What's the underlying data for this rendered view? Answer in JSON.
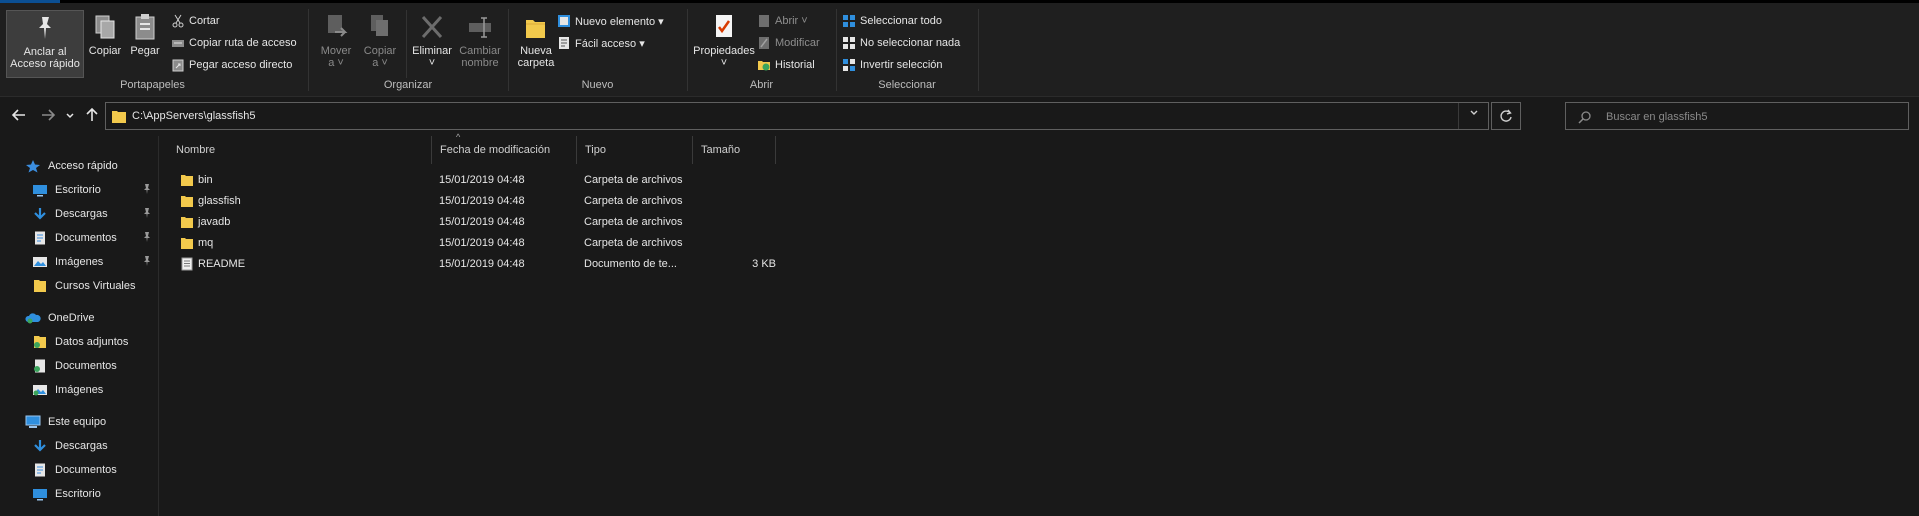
{
  "ribbon": {
    "portapapeles": {
      "label": "Portapapeles",
      "anclar_line1": "Anclar al",
      "anclar_line2": "Acceso rápido",
      "copiar": "Copiar",
      "pegar": "Pegar",
      "cortar": "Cortar",
      "copiar_ruta": "Copiar ruta de acceso",
      "pegar_acceso": "Pegar acceso directo"
    },
    "organizar": {
      "label": "Organizar",
      "mover_line1": "Mover",
      "mover_line2": "a ˅",
      "copiar_line1": "Copiar",
      "copiar_line2": "a ˅",
      "eliminar_line1": "Eliminar",
      "eliminar_line2": "˅",
      "cambiar_line1": "Cambiar",
      "cambiar_line2": "nombre"
    },
    "nuevo": {
      "label": "Nuevo",
      "carpeta_line1": "Nueva",
      "carpeta_line2": "carpeta",
      "nuevo_elemento": "Nuevo elemento ▾",
      "facil_acceso": "Fácil acceso ▾"
    },
    "abrir": {
      "label": "Abrir",
      "propiedades_line1": "Propiedades",
      "propiedades_line2": "˅",
      "abrir": "Abrir ˅",
      "modificar": "Modificar",
      "historial": "Historial"
    },
    "seleccionar": {
      "label": "Seleccionar",
      "todo": "Seleccionar todo",
      "nada": "No seleccionar nada",
      "invertir": "Invertir selección"
    }
  },
  "address": {
    "path": "C:\\AppServers\\glassfish5",
    "search_placeholder": "Buscar en glassfish5"
  },
  "nav": {
    "acceso_rapido": "Acceso rápido",
    "quick": [
      "Escritorio",
      "Descargas",
      "Documentos",
      "Imágenes",
      "Cursos Virtuales"
    ],
    "onedrive": "OneDrive",
    "onedrive_items": [
      "Datos adjuntos",
      "Documentos",
      "Imágenes"
    ],
    "este_equipo": "Este equipo",
    "pc_items": [
      "Descargas",
      "Documentos",
      "Escritorio"
    ]
  },
  "columns": {
    "nombre": "Nombre",
    "fecha": "Fecha de modificación",
    "tipo": "Tipo",
    "tamano": "Tamaño"
  },
  "files": [
    {
      "name": "bin",
      "date": "15/01/2019 04:48",
      "type": "Carpeta de archivos",
      "size": ""
    },
    {
      "name": "glassfish",
      "date": "15/01/2019 04:48",
      "type": "Carpeta de archivos",
      "size": ""
    },
    {
      "name": "javadb",
      "date": "15/01/2019 04:48",
      "type": "Carpeta de archivos",
      "size": ""
    },
    {
      "name": "mq",
      "date": "15/01/2019 04:48",
      "type": "Carpeta de archivos",
      "size": ""
    },
    {
      "name": "README",
      "date": "15/01/2019 04:48",
      "type": "Documento de te...",
      "size": "3 KB"
    }
  ],
  "colors": {
    "background": "#191919",
    "ribbon": "#1f1f1f",
    "folder": "#f2c94c",
    "accent": "#2f8fde"
  }
}
